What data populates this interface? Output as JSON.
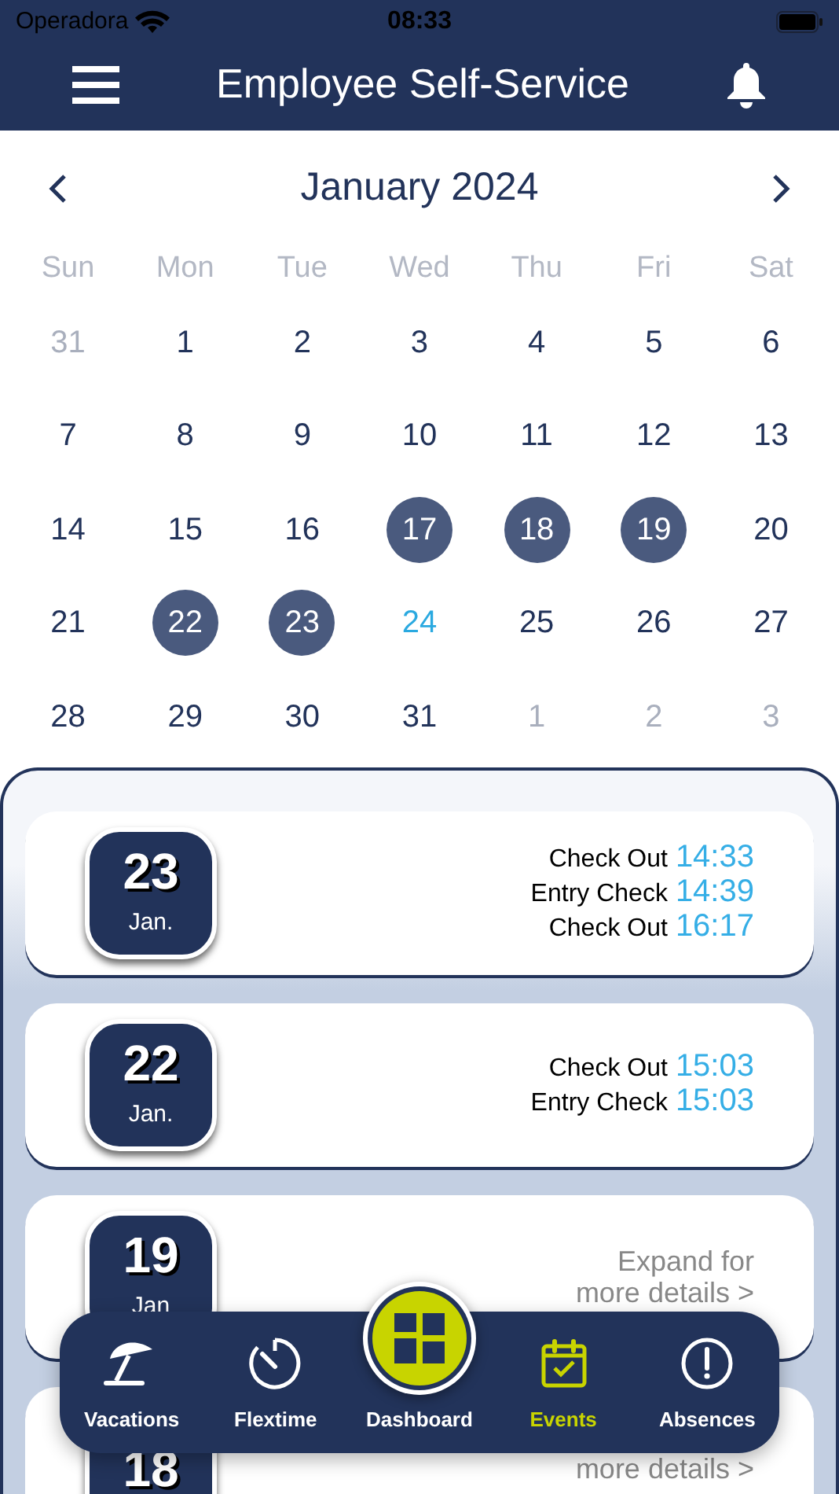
{
  "status_bar": {
    "carrier": "Operadora",
    "time": "08:33"
  },
  "header": {
    "title": "Employee Self-Service"
  },
  "calendar": {
    "month": "January 2024",
    "weekdays": [
      "Sun",
      "Mon",
      "Tue",
      "Wed",
      "Thu",
      "Fri",
      "Sat"
    ],
    "days": [
      {
        "label": "31",
        "in_month": false,
        "selected": false,
        "today": false
      },
      {
        "label": "1",
        "in_month": true,
        "selected": false,
        "today": false
      },
      {
        "label": "2",
        "in_month": true,
        "selected": false,
        "today": false
      },
      {
        "label": "3",
        "in_month": true,
        "selected": false,
        "today": false
      },
      {
        "label": "4",
        "in_month": true,
        "selected": false,
        "today": false
      },
      {
        "label": "5",
        "in_month": true,
        "selected": false,
        "today": false
      },
      {
        "label": "6",
        "in_month": true,
        "selected": false,
        "today": false
      },
      {
        "label": "7",
        "in_month": true,
        "selected": false,
        "today": false
      },
      {
        "label": "8",
        "in_month": true,
        "selected": false,
        "today": false
      },
      {
        "label": "9",
        "in_month": true,
        "selected": false,
        "today": false
      },
      {
        "label": "10",
        "in_month": true,
        "selected": false,
        "today": false
      },
      {
        "label": "11",
        "in_month": true,
        "selected": false,
        "today": false
      },
      {
        "label": "12",
        "in_month": true,
        "selected": false,
        "today": false
      },
      {
        "label": "13",
        "in_month": true,
        "selected": false,
        "today": false
      },
      {
        "label": "14",
        "in_month": true,
        "selected": false,
        "today": false
      },
      {
        "label": "15",
        "in_month": true,
        "selected": false,
        "today": false
      },
      {
        "label": "16",
        "in_month": true,
        "selected": false,
        "today": false
      },
      {
        "label": "17",
        "in_month": true,
        "selected": true,
        "today": false
      },
      {
        "label": "18",
        "in_month": true,
        "selected": true,
        "today": false
      },
      {
        "label": "19",
        "in_month": true,
        "selected": true,
        "today": false
      },
      {
        "label": "20",
        "in_month": true,
        "selected": false,
        "today": false
      },
      {
        "label": "21",
        "in_month": true,
        "selected": false,
        "today": false
      },
      {
        "label": "22",
        "in_month": true,
        "selected": true,
        "today": false
      },
      {
        "label": "23",
        "in_month": true,
        "selected": true,
        "today": false
      },
      {
        "label": "24",
        "in_month": true,
        "selected": false,
        "today": true
      },
      {
        "label": "25",
        "in_month": true,
        "selected": false,
        "today": false
      },
      {
        "label": "26",
        "in_month": true,
        "selected": false,
        "today": false
      },
      {
        "label": "27",
        "in_month": true,
        "selected": false,
        "today": false
      },
      {
        "label": "28",
        "in_month": true,
        "selected": false,
        "today": false
      },
      {
        "label": "29",
        "in_month": true,
        "selected": false,
        "today": false
      },
      {
        "label": "30",
        "in_month": true,
        "selected": false,
        "today": false
      },
      {
        "label": "31",
        "in_month": true,
        "selected": false,
        "today": false
      },
      {
        "label": "1",
        "in_month": false,
        "selected": false,
        "today": false
      },
      {
        "label": "2",
        "in_month": false,
        "selected": false,
        "today": false
      },
      {
        "label": "3",
        "in_month": false,
        "selected": false,
        "today": false
      }
    ]
  },
  "events": [
    {
      "day": "23",
      "month": "Jan.",
      "entries": [
        {
          "label": "Check Out",
          "time": "14:33"
        },
        {
          "label": "Entry Check",
          "time": "14:39"
        },
        {
          "label": "Check Out",
          "time": "16:17"
        }
      ]
    },
    {
      "day": "22",
      "month": "Jan.",
      "entries": [
        {
          "label": "Check Out",
          "time": "15:03"
        },
        {
          "label": "Entry Check",
          "time": "15:03"
        }
      ]
    },
    {
      "day": "19",
      "month": "Jan",
      "expand": "Expand for more details >"
    },
    {
      "day": "18",
      "expand": "more details >"
    }
  ],
  "nav": [
    {
      "kind": "vacations",
      "label": "Vacations",
      "selected": false
    },
    {
      "kind": "flextime",
      "label": "Flextime",
      "selected": false
    },
    {
      "kind": "dashboard",
      "label": "Dashboard",
      "selected": false
    },
    {
      "kind": "events",
      "label": "Events",
      "selected": true
    },
    {
      "kind": "absences",
      "label": "Absences",
      "selected": false
    }
  ]
}
